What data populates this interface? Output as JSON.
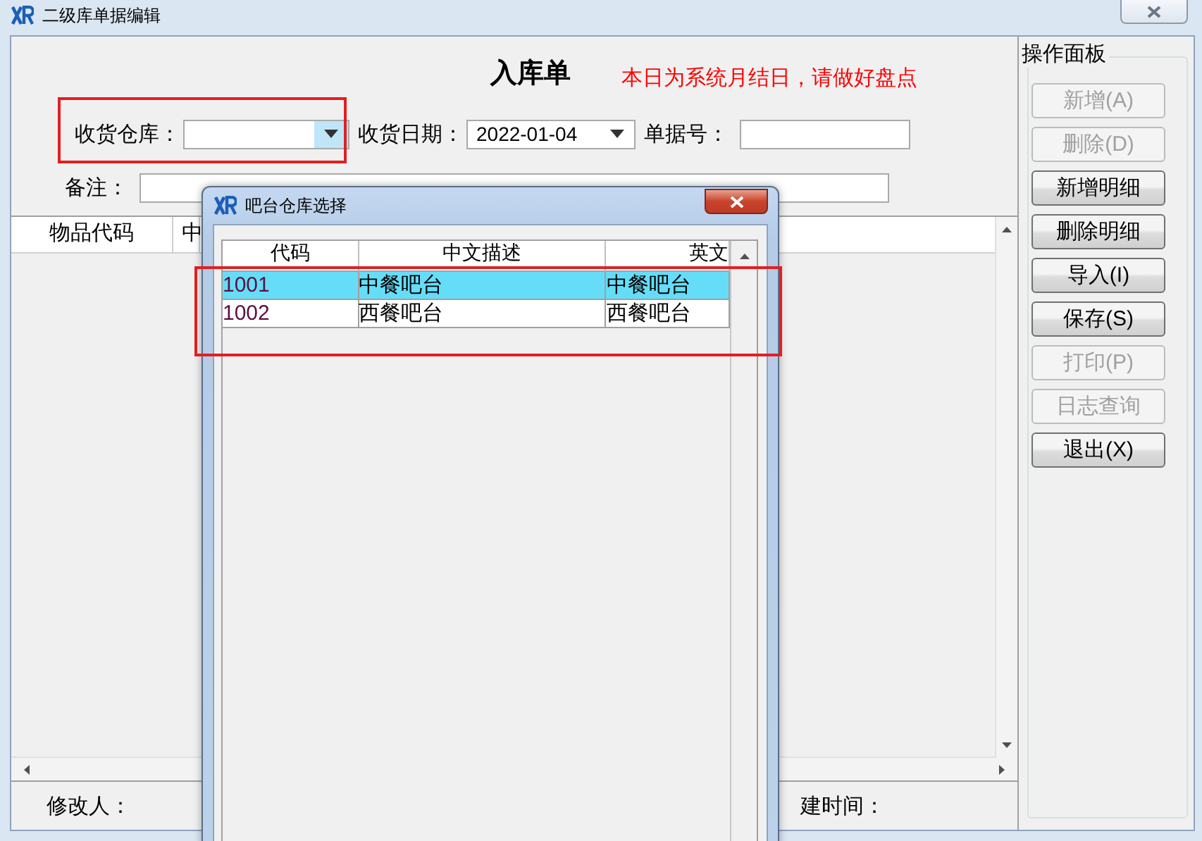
{
  "window": {
    "title": "二级库单据编辑"
  },
  "form": {
    "title": "入库单",
    "notice": "本日为系统月结日，请做好盘点",
    "fields": [
      {
        "label": "收货仓库：",
        "kind": "combo",
        "highlighted": true
      },
      {
        "label": "收货日期：",
        "kind": "combo",
        "value": "2022-01-04",
        "highlighted": false
      },
      {
        "label": "单据号：",
        "kind": "text",
        "highlighted": false
      },
      {
        "label": "备注：",
        "kind": "text",
        "highlighted": false
      }
    ],
    "grid": {
      "columns": [
        "物品代码",
        "中"
      ]
    },
    "footer": [
      "修改人：",
      "建时间："
    ]
  },
  "panel": {
    "title": "操作面板",
    "buttons": [
      {
        "label": "新增(A)",
        "disabled": true
      },
      {
        "label": "删除(D)",
        "disabled": true
      },
      {
        "label": "新增明细",
        "disabled": false
      },
      {
        "label": "删除明细",
        "disabled": false
      },
      {
        "label": "导入(I)",
        "disabled": false
      },
      {
        "label": "保存(S)",
        "disabled": false
      },
      {
        "label": "打印(P)",
        "disabled": true
      },
      {
        "label": "日志查询",
        "disabled": true
      },
      {
        "label": "退出(X)",
        "disabled": false
      }
    ]
  },
  "dialog": {
    "title": "吧台仓库选择",
    "table": {
      "highlighted": true,
      "columns": [
        "代码",
        "中文描述",
        "英文"
      ],
      "rows": [
        {
          "cells": [
            "1001",
            "中餐吧台",
            "中餐吧台"
          ],
          "selected": true
        },
        {
          "cells": [
            "1002",
            "西餐吧台",
            "西餐吧台"
          ],
          "selected": false
        }
      ]
    }
  }
}
